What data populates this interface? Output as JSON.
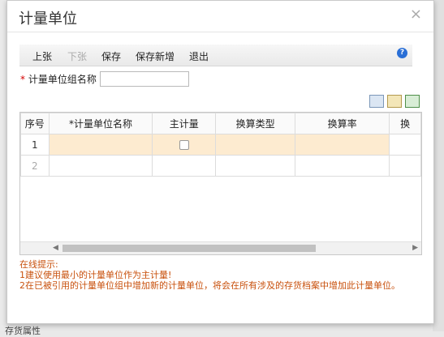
{
  "dialog": {
    "title": "计量单位",
    "close_glyph": "×"
  },
  "toolbar": {
    "prev": "上张",
    "next": "下张",
    "save": "保存",
    "save_new": "保存新增",
    "exit": "退出",
    "help_glyph": "?"
  },
  "form": {
    "required_mark": "*",
    "group_name_label": "计量单位组名称",
    "group_name_value": ""
  },
  "grid": {
    "columns": [
      "序号",
      "*计量单位名称",
      "主计量",
      "换算类型",
      "换算率",
      "换"
    ],
    "rows": [
      {
        "index": "1",
        "name": "",
        "primary": false,
        "conv_type": "",
        "rate": ""
      },
      {
        "index": "2",
        "name": "",
        "primary": null,
        "conv_type": "",
        "rate": ""
      }
    ]
  },
  "hints": {
    "title": "在线提示:",
    "line1": "1建议使用最小的计量单位作为主计量!",
    "line2": "2在已被引用的计量单位组中增加新的计量单位，将会在所有涉及的存货档案中增加此计量单位。"
  },
  "background": {
    "partial_text": "存货属性"
  }
}
